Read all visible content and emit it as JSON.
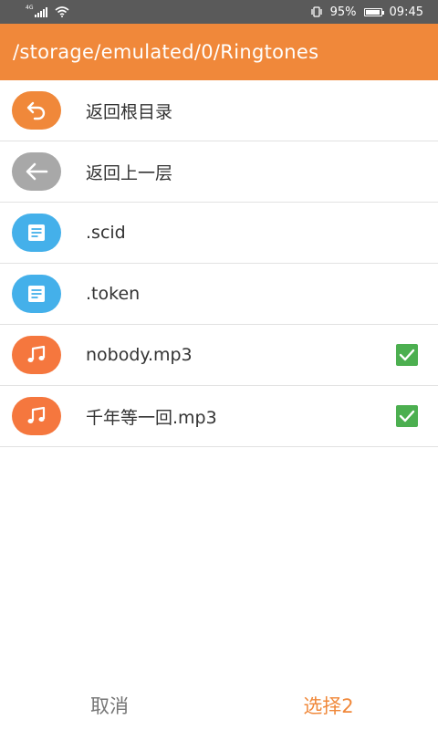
{
  "status_bar": {
    "network": "4G",
    "battery": "95%",
    "battery_level": 0.95,
    "time": "09:45"
  },
  "header": {
    "path": "/storage/emulated/0/Ringtones"
  },
  "colors": {
    "accent": "#f0883a",
    "status_bar": "#5a5a5a",
    "icon_back_root": "#f0883a",
    "icon_up": "#a8a8a8",
    "icon_file": "#44b0ea",
    "icon_music": "#f5773e",
    "checkbox": "#4caf50",
    "cancel_text": "#757575",
    "select_text": "#f0883a"
  },
  "rows": [
    {
      "label": "返回根目录",
      "icon": "undo-icon",
      "checked": false
    },
    {
      "label": "返回上一层",
      "icon": "arrow-left-icon",
      "checked": false
    },
    {
      "label": ".scid",
      "icon": "document-icon",
      "checked": false
    },
    {
      "label": ".token",
      "icon": "document-icon",
      "checked": false
    },
    {
      "label": "nobody.mp3",
      "icon": "music-note-icon",
      "checked": true
    },
    {
      "label": "千年等一回.mp3",
      "icon": "music-note-icon",
      "checked": true
    }
  ],
  "footer": {
    "cancel_label": "取消",
    "select_label": "选择2"
  }
}
